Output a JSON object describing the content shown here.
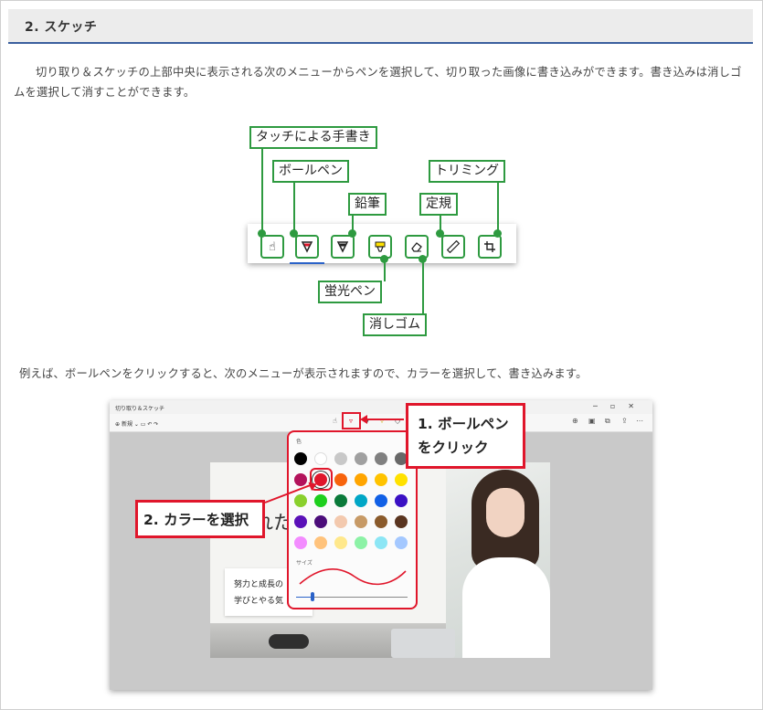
{
  "section": {
    "title": "2. スケッチ"
  },
  "intro": "切り取り＆スケッチの上部中央に表示される次のメニューからペンを選択して、切り取った画像に書き込みができます。書き込みは消しゴムを選択して消すことができます。",
  "diagram": {
    "labels": {
      "touch": "タッチによる手書き",
      "ballpoint": "ボールペン",
      "pencil": "鉛筆",
      "ruler": "定規",
      "crop": "トリミング",
      "highlighter": "蛍光ペン",
      "eraser": "消しゴム"
    },
    "icons": [
      "touch-writing-icon",
      "ballpoint-pen-icon",
      "pencil-icon",
      "highlighter-icon",
      "eraser-icon",
      "ruler-icon",
      "crop-icon"
    ],
    "accent_color": "#2e9a40"
  },
  "example": "例えば、ボールペンをクリックすると、次のメニューが表示されますので、カラーを選択して、書き込みます。",
  "screenshot": {
    "window_title": "切り取り＆スケッチ",
    "new_label": "新規",
    "canvas_text": "れた",
    "card_lines": [
      "努力と成長の",
      "学びとやる気"
    ],
    "panel": {
      "title": "色",
      "size_label": "サイズ",
      "selected_color": "#e0162b",
      "colors": [
        [
          "#000000",
          "#ffffff",
          "#c8c8c8",
          "#a0a0a0",
          "#808080",
          "#686868"
        ],
        [
          "#b3135c",
          "#e0162b",
          "#f7630c",
          "#ffa500",
          "#ffc300",
          "#ffe100"
        ],
        [
          "#8ad02d",
          "#1ecf1e",
          "#0a7a3a",
          "#00a6c6",
          "#1160e6",
          "#3a10c4"
        ],
        [
          "#5a10b8",
          "#4b0d7a",
          "#f3c9ae",
          "#c79a66",
          "#8a5a2b",
          "#5a3520"
        ],
        [
          "#f38cff",
          "#ffc37c",
          "#ffe88c",
          "#8cf2a6",
          "#8ce6f5",
          "#a4c8ff"
        ]
      ]
    }
  },
  "callouts": {
    "step1": [
      "1. ボールペン",
      "をクリック"
    ],
    "step2": "2. カラーを選択",
    "color": "#e0162b"
  }
}
